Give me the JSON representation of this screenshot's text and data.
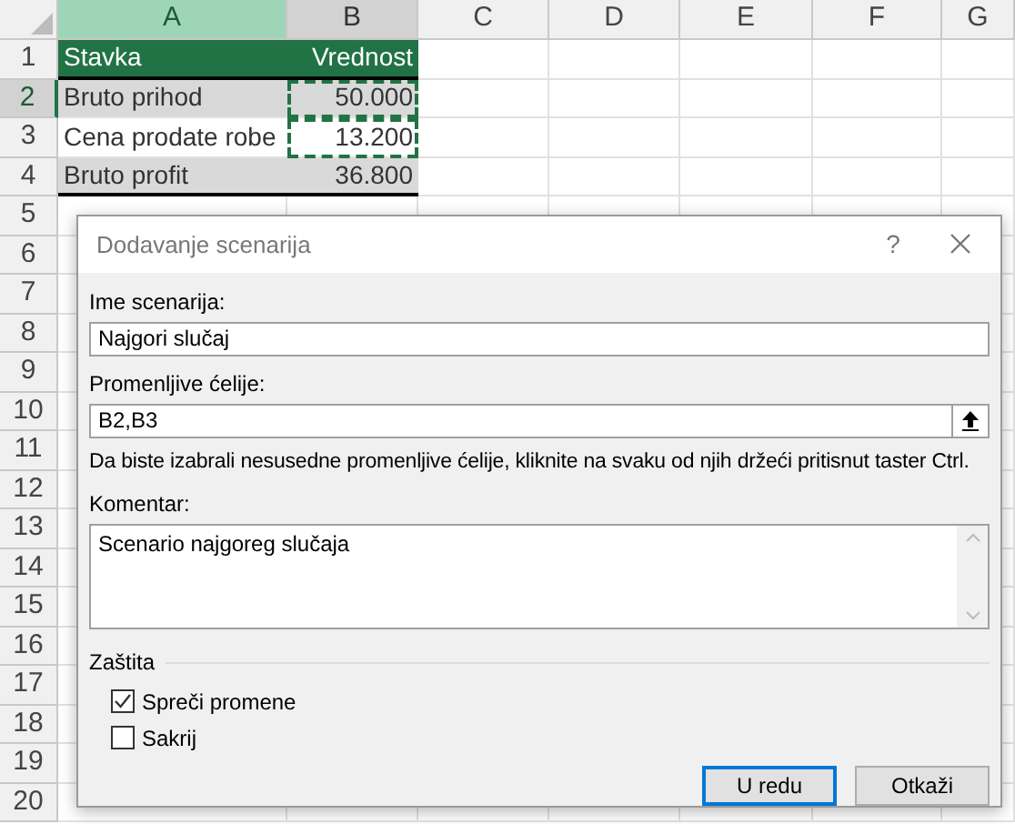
{
  "sheet": {
    "columns": [
      {
        "label": "A",
        "active": true,
        "selected": true
      },
      {
        "label": "B",
        "active": false,
        "selected": true
      },
      {
        "label": "C",
        "active": false,
        "selected": false
      },
      {
        "label": "D",
        "active": false,
        "selected": false
      },
      {
        "label": "E",
        "active": false,
        "selected": false
      },
      {
        "label": "F",
        "active": false,
        "selected": false
      },
      {
        "label": "G",
        "active": false,
        "selected": false
      }
    ],
    "row_numbers": [
      {
        "label": "1",
        "selected": false
      },
      {
        "label": "2",
        "selected": true
      },
      {
        "label": "3",
        "selected": false
      },
      {
        "label": "4",
        "selected": false
      },
      {
        "label": "5",
        "selected": false
      },
      {
        "label": "6",
        "selected": false
      },
      {
        "label": "7",
        "selected": false
      },
      {
        "label": "8",
        "selected": false
      },
      {
        "label": "9",
        "selected": false
      },
      {
        "label": "10",
        "selected": false
      },
      {
        "label": "11",
        "selected": false
      },
      {
        "label": "12",
        "selected": false
      },
      {
        "label": "13",
        "selected": false
      },
      {
        "label": "14",
        "selected": false
      },
      {
        "label": "15",
        "selected": false
      },
      {
        "label": "16",
        "selected": false
      },
      {
        "label": "17",
        "selected": false
      },
      {
        "label": "18",
        "selected": false
      },
      {
        "label": "19",
        "selected": false
      },
      {
        "label": "20",
        "selected": false
      }
    ],
    "rows": [
      {
        "header": true,
        "cells": [
          {
            "text": "Stavka",
            "marquee": false
          },
          {
            "text": "Vrednost",
            "marquee": false
          }
        ]
      },
      {
        "header": false,
        "shaded": true,
        "cells": [
          {
            "text": "Bruto prihod",
            "marquee": false
          },
          {
            "text": "50.000",
            "marquee": true
          }
        ]
      },
      {
        "header": false,
        "shaded": false,
        "cells": [
          {
            "text": "Cena prodate robe",
            "marquee": false
          },
          {
            "text": "13.200",
            "marquee": true
          }
        ]
      },
      {
        "header": false,
        "shaded": true,
        "cells": [
          {
            "text": "Bruto profit",
            "marquee": false
          },
          {
            "text": "36.800",
            "marquee": false
          }
        ]
      }
    ]
  },
  "dialog": {
    "title": "Dodavanje scenarija",
    "help": "?",
    "name_field": {
      "label": "Ime scenarija:",
      "value": "Najgori slučaj"
    },
    "cells_field": {
      "label": "Promenljive ćelije:",
      "value": "B2,B3"
    },
    "hint": "Da biste izabrali nesusedne promenljive ćelije, kliknite na svaku od njih držeći pritisnut taster Ctrl.",
    "comment_field": {
      "label": "Komentar:",
      "value": "Scenario najgoreg slučaja"
    },
    "protection": {
      "title": "Zaštita",
      "options": [
        {
          "label": "Spreči promene",
          "checked": true
        },
        {
          "label": "Sakrij",
          "checked": false
        }
      ]
    },
    "buttons": [
      {
        "label": "U redu",
        "default": true
      },
      {
        "label": "Otkaži",
        "default": false
      }
    ]
  }
}
